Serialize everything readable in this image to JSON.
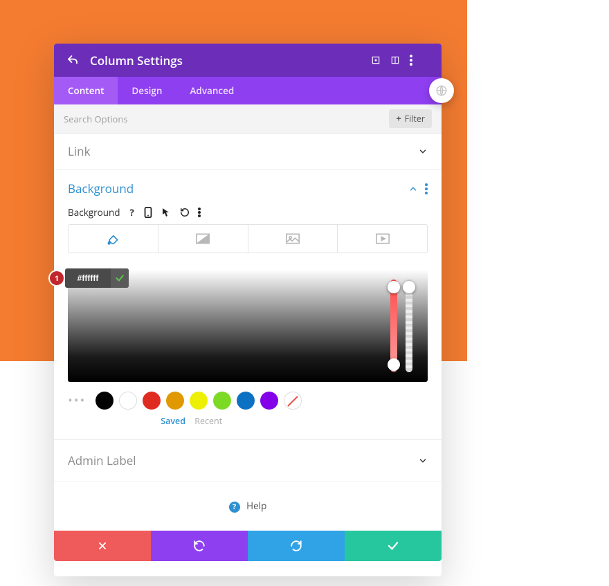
{
  "header": {
    "title": "Column Settings"
  },
  "tabs": {
    "items": [
      "Content",
      "Design",
      "Advanced"
    ],
    "active": 0
  },
  "search": {
    "placeholder": "Search Options",
    "filter_label": "Filter"
  },
  "sections": {
    "link": {
      "title": "Link",
      "expanded": false
    },
    "background": {
      "title": "Background",
      "expanded": true,
      "field_label": "Background",
      "bg_tabs_active": 0,
      "hex_value": "#ffffff",
      "callout_number": "1",
      "swatches": [
        "#000000",
        "#ffffff",
        "#e02b20",
        "#e09900",
        "#edf000",
        "#7cda24",
        "#0c71c3",
        "#8300e9",
        "none"
      ],
      "saved_label": "Saved",
      "recent_label": "Recent"
    },
    "admin_label": {
      "title": "Admin Label",
      "expanded": false
    }
  },
  "help": {
    "label": "Help"
  },
  "footer": {
    "cancel": "cancel",
    "undo": "undo",
    "redo": "redo",
    "save": "save"
  }
}
